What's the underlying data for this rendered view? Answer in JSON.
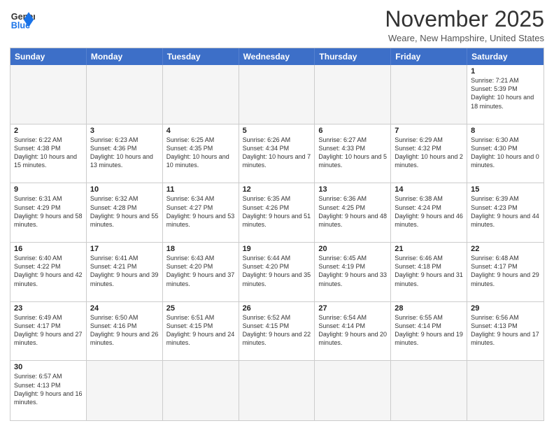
{
  "header": {
    "logo_line1": "General",
    "logo_line2": "Blue",
    "month_title": "November 2025",
    "location": "Weare, New Hampshire, United States"
  },
  "day_headers": [
    "Sunday",
    "Monday",
    "Tuesday",
    "Wednesday",
    "Thursday",
    "Friday",
    "Saturday"
  ],
  "weeks": [
    [
      {
        "day": "",
        "info": "",
        "empty": true
      },
      {
        "day": "",
        "info": "",
        "empty": true
      },
      {
        "day": "",
        "info": "",
        "empty": true
      },
      {
        "day": "",
        "info": "",
        "empty": true
      },
      {
        "day": "",
        "info": "",
        "empty": true
      },
      {
        "day": "",
        "info": "",
        "empty": true
      },
      {
        "day": "1",
        "info": "Sunrise: 7:21 AM\nSunset: 5:39 PM\nDaylight: 10 hours\nand 18 minutes."
      }
    ],
    [
      {
        "day": "2",
        "info": "Sunrise: 6:22 AM\nSunset: 4:38 PM\nDaylight: 10 hours\nand 15 minutes."
      },
      {
        "day": "3",
        "info": "Sunrise: 6:23 AM\nSunset: 4:36 PM\nDaylight: 10 hours\nand 13 minutes."
      },
      {
        "day": "4",
        "info": "Sunrise: 6:25 AM\nSunset: 4:35 PM\nDaylight: 10 hours\nand 10 minutes."
      },
      {
        "day": "5",
        "info": "Sunrise: 6:26 AM\nSunset: 4:34 PM\nDaylight: 10 hours\nand 7 minutes."
      },
      {
        "day": "6",
        "info": "Sunrise: 6:27 AM\nSunset: 4:33 PM\nDaylight: 10 hours\nand 5 minutes."
      },
      {
        "day": "7",
        "info": "Sunrise: 6:29 AM\nSunset: 4:32 PM\nDaylight: 10 hours\nand 2 minutes."
      },
      {
        "day": "8",
        "info": "Sunrise: 6:30 AM\nSunset: 4:30 PM\nDaylight: 10 hours\nand 0 minutes."
      }
    ],
    [
      {
        "day": "9",
        "info": "Sunrise: 6:31 AM\nSunset: 4:29 PM\nDaylight: 9 hours\nand 58 minutes."
      },
      {
        "day": "10",
        "info": "Sunrise: 6:32 AM\nSunset: 4:28 PM\nDaylight: 9 hours\nand 55 minutes."
      },
      {
        "day": "11",
        "info": "Sunrise: 6:34 AM\nSunset: 4:27 PM\nDaylight: 9 hours\nand 53 minutes."
      },
      {
        "day": "12",
        "info": "Sunrise: 6:35 AM\nSunset: 4:26 PM\nDaylight: 9 hours\nand 51 minutes."
      },
      {
        "day": "13",
        "info": "Sunrise: 6:36 AM\nSunset: 4:25 PM\nDaylight: 9 hours\nand 48 minutes."
      },
      {
        "day": "14",
        "info": "Sunrise: 6:38 AM\nSunset: 4:24 PM\nDaylight: 9 hours\nand 46 minutes."
      },
      {
        "day": "15",
        "info": "Sunrise: 6:39 AM\nSunset: 4:23 PM\nDaylight: 9 hours\nand 44 minutes."
      }
    ],
    [
      {
        "day": "16",
        "info": "Sunrise: 6:40 AM\nSunset: 4:22 PM\nDaylight: 9 hours\nand 42 minutes."
      },
      {
        "day": "17",
        "info": "Sunrise: 6:41 AM\nSunset: 4:21 PM\nDaylight: 9 hours\nand 39 minutes."
      },
      {
        "day": "18",
        "info": "Sunrise: 6:43 AM\nSunset: 4:20 PM\nDaylight: 9 hours\nand 37 minutes."
      },
      {
        "day": "19",
        "info": "Sunrise: 6:44 AM\nSunset: 4:20 PM\nDaylight: 9 hours\nand 35 minutes."
      },
      {
        "day": "20",
        "info": "Sunrise: 6:45 AM\nSunset: 4:19 PM\nDaylight: 9 hours\nand 33 minutes."
      },
      {
        "day": "21",
        "info": "Sunrise: 6:46 AM\nSunset: 4:18 PM\nDaylight: 9 hours\nand 31 minutes."
      },
      {
        "day": "22",
        "info": "Sunrise: 6:48 AM\nSunset: 4:17 PM\nDaylight: 9 hours\nand 29 minutes."
      }
    ],
    [
      {
        "day": "23",
        "info": "Sunrise: 6:49 AM\nSunset: 4:17 PM\nDaylight: 9 hours\nand 27 minutes."
      },
      {
        "day": "24",
        "info": "Sunrise: 6:50 AM\nSunset: 4:16 PM\nDaylight: 9 hours\nand 26 minutes."
      },
      {
        "day": "25",
        "info": "Sunrise: 6:51 AM\nSunset: 4:15 PM\nDaylight: 9 hours\nand 24 minutes."
      },
      {
        "day": "26",
        "info": "Sunrise: 6:52 AM\nSunset: 4:15 PM\nDaylight: 9 hours\nand 22 minutes."
      },
      {
        "day": "27",
        "info": "Sunrise: 6:54 AM\nSunset: 4:14 PM\nDaylight: 9 hours\nand 20 minutes."
      },
      {
        "day": "28",
        "info": "Sunrise: 6:55 AM\nSunset: 4:14 PM\nDaylight: 9 hours\nand 19 minutes."
      },
      {
        "day": "29",
        "info": "Sunrise: 6:56 AM\nSunset: 4:13 PM\nDaylight: 9 hours\nand 17 minutes."
      }
    ],
    [
      {
        "day": "30",
        "info": "Sunrise: 6:57 AM\nSunset: 4:13 PM\nDaylight: 9 hours\nand 16 minutes."
      },
      {
        "day": "",
        "info": "",
        "empty": true
      },
      {
        "day": "",
        "info": "",
        "empty": true
      },
      {
        "day": "",
        "info": "",
        "empty": true
      },
      {
        "day": "",
        "info": "",
        "empty": true
      },
      {
        "day": "",
        "info": "",
        "empty": true
      },
      {
        "day": "",
        "info": "",
        "empty": true
      }
    ]
  ]
}
